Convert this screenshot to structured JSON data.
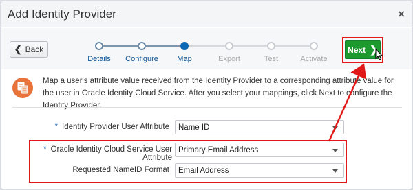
{
  "dialog": {
    "title": "Add Identity Provider"
  },
  "header": {
    "close_glyph": "×"
  },
  "back_button": {
    "label": "Back",
    "icon": "chevron-left-icon"
  },
  "next_button": {
    "label": "Next",
    "icon": "chevron-right-icon"
  },
  "train": {
    "steps": [
      {
        "label": "Details",
        "state": "visited"
      },
      {
        "label": "Configure",
        "state": "visited"
      },
      {
        "label": "Map",
        "state": "current"
      },
      {
        "label": "Export",
        "state": "future"
      },
      {
        "label": "Test",
        "state": "future"
      },
      {
        "label": "Activate",
        "state": "future"
      }
    ]
  },
  "info": {
    "text": "Map a user's attribute value received from the Identity Provider to a corresponding attribute value for the user in Oracle Identity Cloud Service. After you select your mappings, click Next to configure the Identity Provider.",
    "icon": "mapping-document-icon"
  },
  "form": {
    "required_marker": "*",
    "idp_attribute": {
      "label": "Identity Provider User Attribute",
      "value": "Name ID",
      "required": true
    },
    "idcs_attribute": {
      "label": "Oracle Identity Cloud Service User Attribute",
      "value": "Primary Email Address",
      "required": true
    },
    "nameid_format": {
      "label": "Requested NameID Format",
      "value": "Email Address",
      "required": false
    }
  },
  "colors": {
    "accent": "#0b68b5",
    "next_green": "#1c9a2f",
    "annotation_red": "#e01818",
    "info_orange": "#e8743b"
  }
}
